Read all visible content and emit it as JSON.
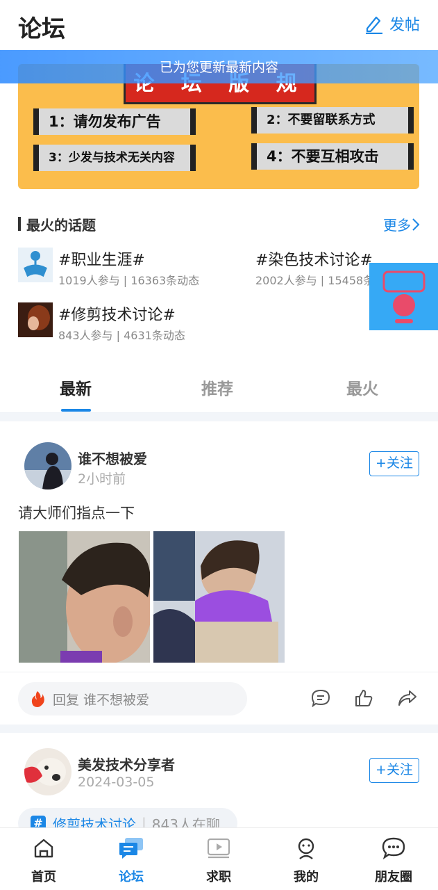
{
  "header": {
    "title": "论坛",
    "post_label": "发帖"
  },
  "toast": "已为您更新最新内容",
  "banner": {
    "title": "论 坛 版 规",
    "rules": [
      "1：请勿发布广告",
      "2：不要留联系方式",
      "3：少发与技术无关内容",
      "4：不要互相攻击"
    ]
  },
  "hot_topics": {
    "heading": "最火的话题",
    "more": "更多",
    "items": [
      {
        "name": "#职业生涯#",
        "stats": "1019人参与 | 16363条动态"
      },
      {
        "name": "#染色技术讨论#",
        "stats": "2002人参与 | 15458条"
      },
      {
        "name": "#修剪技术讨论#",
        "stats": "843人参与 | 4631条动态"
      }
    ]
  },
  "tabs": [
    "最新",
    "推荐",
    "最火"
  ],
  "posts": [
    {
      "username": "谁不想被爱",
      "time": "2小时前",
      "follow": "+关注",
      "text": "请大师们指点一下",
      "reply_placeholder": "回复 谁不想被爱"
    },
    {
      "username": "美发技术分享者",
      "time": "2024-03-05",
      "follow": "+关注",
      "topic_name": "修剪技术讨论",
      "topic_count": "843人在聊"
    }
  ],
  "bottom_nav": [
    {
      "label": "首页",
      "icon": "home-icon"
    },
    {
      "label": "论坛",
      "icon": "forum-icon"
    },
    {
      "label": "求职",
      "icon": "video-icon"
    },
    {
      "label": "我的",
      "icon": "profile-icon"
    },
    {
      "label": "朋友圈",
      "icon": "moments-icon"
    }
  ],
  "colors": {
    "accent": "#1b87e6",
    "banner_bg": "#fbbd4c",
    "banner_title_bg": "#d6281e"
  }
}
